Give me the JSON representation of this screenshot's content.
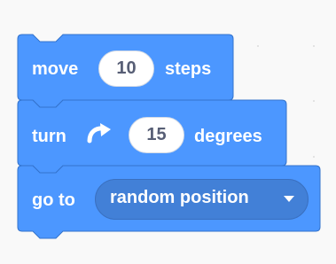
{
  "blocks": {
    "move": {
      "label_before": "move",
      "value": "10",
      "label_after": "steps"
    },
    "turn": {
      "label_before": "turn",
      "icon": "rotate-clockwise-icon",
      "value": "15",
      "label_after": "degrees"
    },
    "goto": {
      "label": "go to",
      "dropdown_value": "random position",
      "dropdown_icon": "caret-down-icon"
    }
  },
  "colors": {
    "block_fill": "#4c97ff",
    "block_border": "#3373cc",
    "dropdown_fill": "#4280d7",
    "input_text": "#575e75",
    "workspace": "#f9f9f9"
  }
}
